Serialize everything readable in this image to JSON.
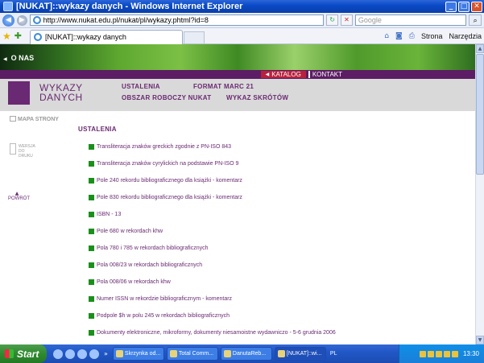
{
  "window": {
    "title": "[NUKAT]::wykazy danych - Windows Internet Explorer"
  },
  "browser": {
    "address": "http://www.nukat.edu.pl/nukat/pl/wykazy.phtml?id=8",
    "search_placeholder": "Google",
    "tab_title": "[NUKAT]::wykazy danych",
    "tools": {
      "page": "Strona",
      "tools": "Narzędzia"
    }
  },
  "site": {
    "banner_link": "O NAS",
    "nav": {
      "katalog": "KATALOG",
      "kontakt": "KONTAKT"
    },
    "logo": {
      "line1": "WYKAZY",
      "line2": "DANYCH"
    },
    "menu": {
      "ustalenia": "USTALENIA",
      "format": "FORMAT MARC 21",
      "obszar": "OBSZAR ROBOCZY NUKAT",
      "skroty": "WYKAZ SKRÓTÓW"
    },
    "sidebar": {
      "mapa": "MAPA STRONY",
      "wersja": "WERSJA DO DRUKU",
      "powrot": "POWRÓT"
    },
    "section_title": "USTALENIA",
    "items": [
      "Transliteracja znaków greckich zgodnie z PN-ISO 843",
      "Transliteracja znaków cyrylickich na podstawie PN-ISO 9",
      "Pole 240 rekordu bibliograficznego dla książki - komentarz",
      "Pole 830 rekordu bibliograficznego dla książki - komentarz",
      "ISBN - 13",
      "Pole 680 w rekordach khw",
      "Pola 780 i 785 w rekordach bibliograficznych",
      "Pola 008/23 w rekordach bibliograficznych",
      "Pola 008/06 w rekordach khw",
      "Numer ISSN w rekordzie bibliograficznym - komentarz",
      "Podpole $h w polu 245 w rekordach bibliograficznych",
      "Dokumenty elektroniczne, mikroformy, dokumenty niesamoistne wydawniczo - 5-6 grudnia 2006"
    ]
  },
  "taskbar": {
    "start": "Start",
    "tasks": [
      "Skrzynka od...",
      "Total Comm...",
      "DanutaReb...",
      "[NUKAT]::wi..."
    ],
    "lang": "PL",
    "clock": "13:30"
  },
  "colors": {
    "brand_purple": "#6a2973",
    "bullet_green": "#1b8f1b",
    "katalog_red": "#b8213d"
  }
}
